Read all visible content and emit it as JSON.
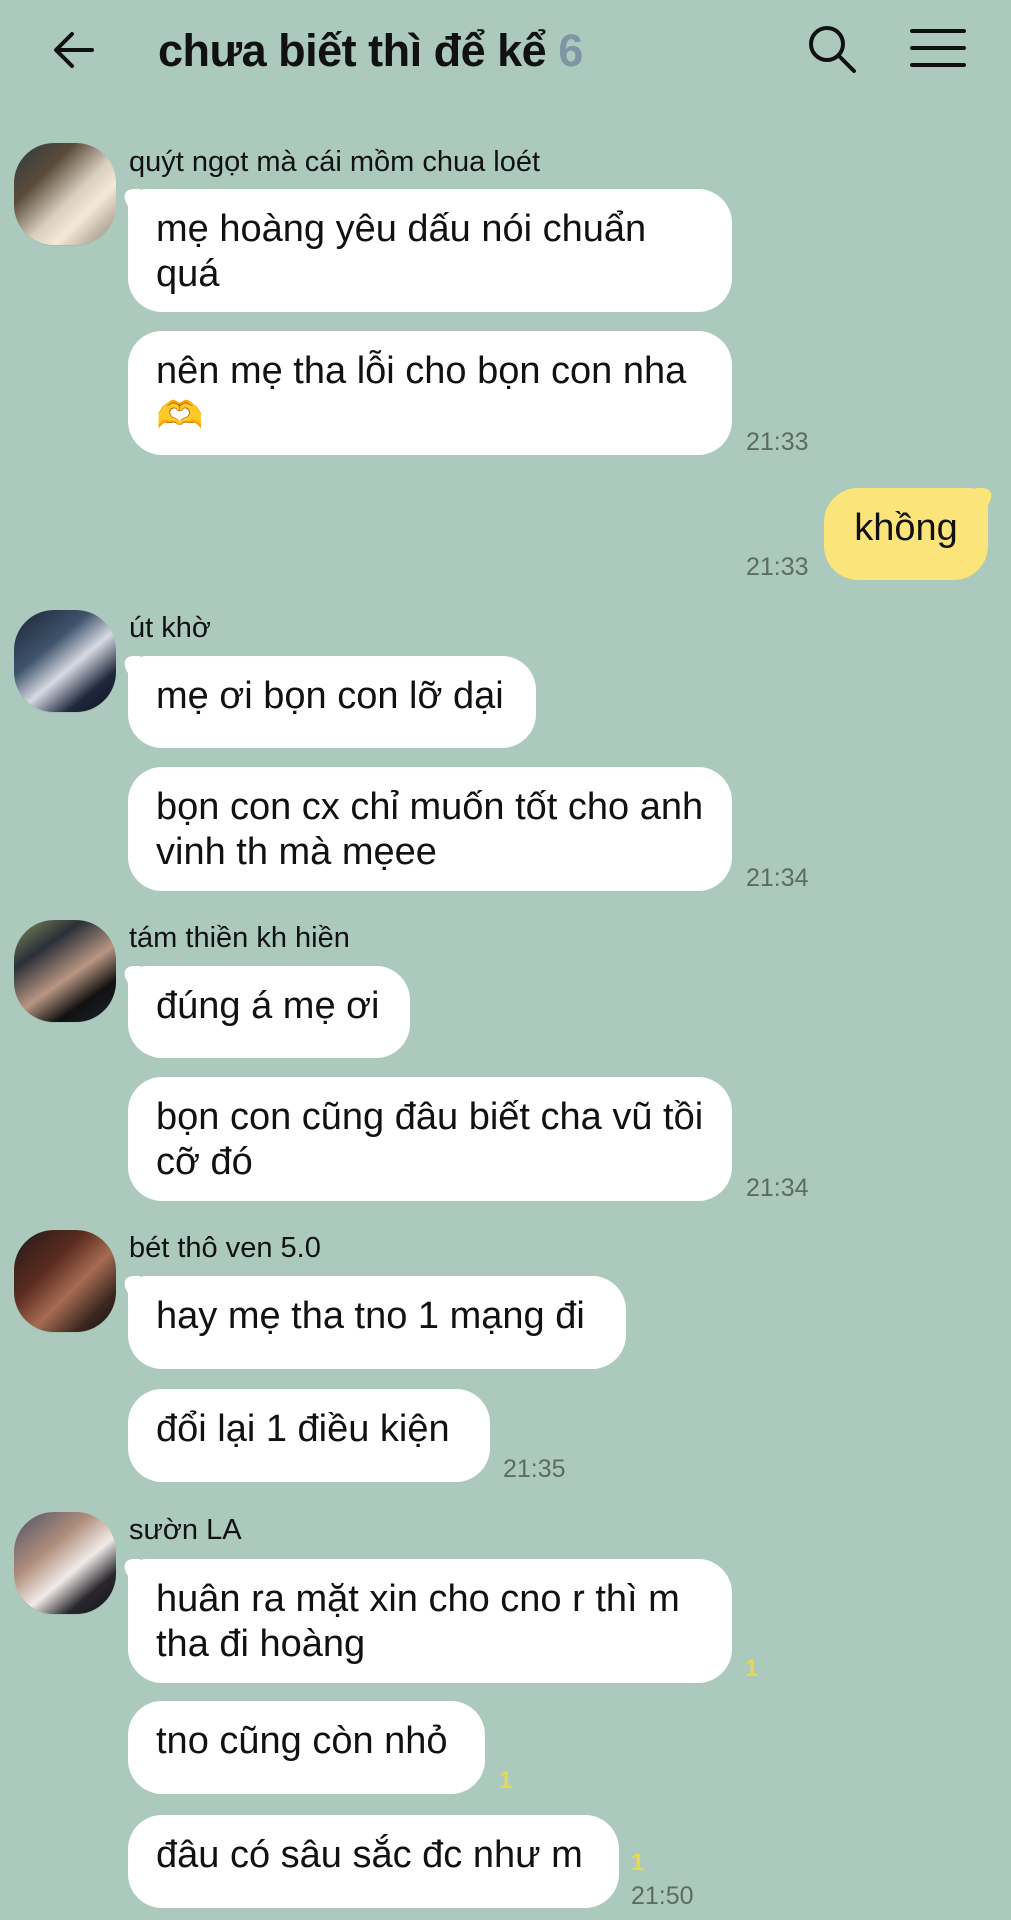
{
  "header": {
    "title": "chưa biết thì để kể",
    "member_count": "6"
  },
  "messages": [
    {
      "sender": "quýt ngọt mà cái mồm chua loét",
      "bubbles": [
        "mẹ hoàng yêu dấu nói chuẩn quá",
        "nên mẹ tha lỗi cho bọn con nha"
      ],
      "emoji": "🫶",
      "time": "21:33"
    },
    {
      "mine": true,
      "text": "khồng",
      "time": "21:33"
    },
    {
      "sender": "út khờ",
      "bubbles": [
        "mẹ ơi bọn con lỡ dại",
        "bọn con cx chỉ muốn tốt cho anh vinh th mà mẹee"
      ],
      "time": "21:34"
    },
    {
      "sender": "tám thiền kh hiền",
      "bubbles": [
        "đúng á mẹ ơi",
        "bọn con cũng đâu biết cha vũ tồi cỡ đó"
      ],
      "time": "21:34"
    },
    {
      "sender": "bét thô ven 5.0",
      "bubbles": [
        "hay mẹ tha tno 1 mạng đi",
        "đổi lại 1 điều kiện"
      ],
      "time": "21:35"
    },
    {
      "sender": "sườn LA",
      "bubbles": [
        "huân ra mặt xin cho cno r thì m tha đi hoàng",
        "tno cũng còn nhỏ",
        "đâu có sâu sắc đc như m"
      ],
      "unread": [
        "1",
        "1",
        "1"
      ],
      "time": "21:50"
    }
  ]
}
